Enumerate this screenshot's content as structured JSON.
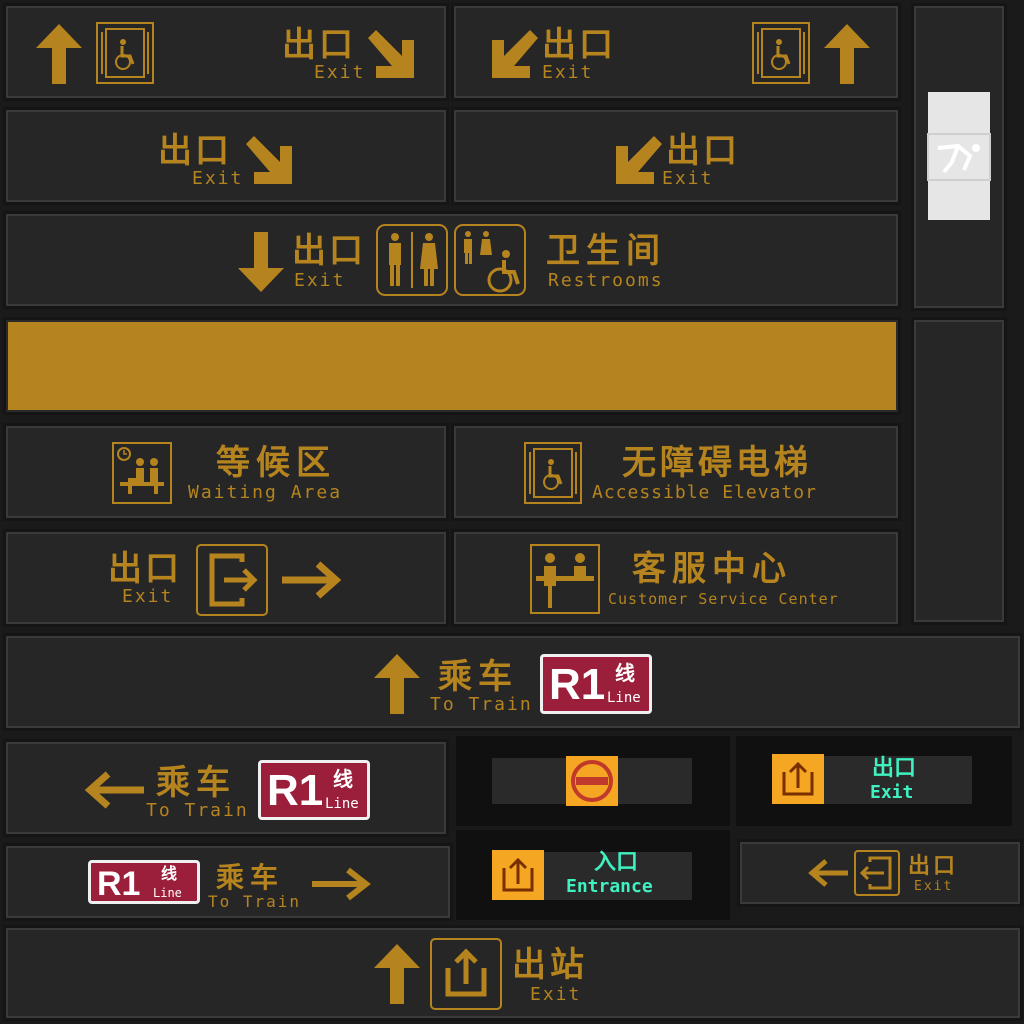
{
  "colors": {
    "gold": "#b5841f",
    "panel": "#262626",
    "led_green": "#3ff0c0",
    "led_orange": "#f5a623",
    "badge_red": "#9b1f3a"
  },
  "icons": [
    "arrow-up-icon",
    "arrow-down-right-icon",
    "arrow-down-left-icon",
    "arrow-down-icon",
    "arrow-left-icon",
    "arrow-right-icon",
    "accessible-elevator-icon",
    "restroom-icon",
    "accessible-restroom-icon",
    "waiting-area-icon",
    "exit-door-icon",
    "customer-service-icon",
    "exit-station-icon",
    "no-entry-icon",
    "entrance-icon",
    "slip-hazard-icon"
  ],
  "sign1": {
    "zh": "出口",
    "en": "Exit"
  },
  "sign2": {
    "zh": "出口",
    "en": "Exit"
  },
  "sign3": {
    "zh": "出口",
    "en": "Exit"
  },
  "sign4": {
    "zh": "出口",
    "en": "Exit"
  },
  "sign5": {
    "exit_zh": "出口",
    "exit_en": "Exit",
    "rest_zh": "卫生间",
    "rest_en": "Restrooms"
  },
  "waiting": {
    "zh": "等候区",
    "en": "Waiting Area"
  },
  "elevator": {
    "zh": "无障碍电梯",
    "en": "Accessible Elevator"
  },
  "exit_right": {
    "zh": "出口",
    "en": "Exit"
  },
  "service": {
    "zh": "客服中心",
    "en": "Customer Service Center"
  },
  "train_up": {
    "zh": "乘车",
    "en": "To Train",
    "badge": "R1",
    "badge_zh": "线",
    "badge_en": "Line"
  },
  "train_left": {
    "zh": "乘车",
    "en": "To Train",
    "badge": "R1",
    "badge_zh": "线",
    "badge_en": "Line"
  },
  "train_right": {
    "zh": "乘车",
    "en": "To Train",
    "badge": "R1",
    "badge_zh": "线",
    "badge_en": "Line"
  },
  "led_exit": {
    "zh": "出口",
    "en": "Exit"
  },
  "led_entrance": {
    "zh": "入口",
    "en": "Entrance"
  },
  "small_exit": {
    "zh": "出口",
    "en": "Exit"
  },
  "exit_station": {
    "zh": "出站",
    "en": "Exit"
  }
}
